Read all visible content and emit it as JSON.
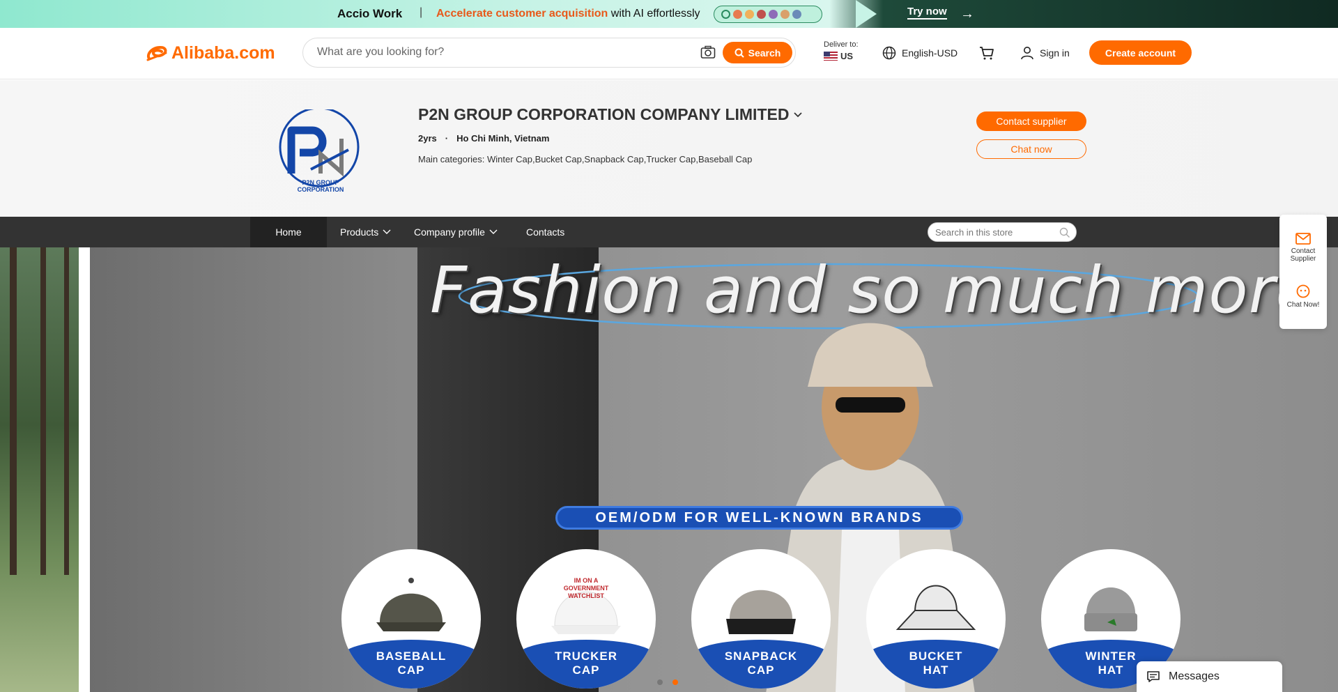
{
  "promo": {
    "brand": "Accio Work",
    "separator": "|",
    "highlight": "Accelerate customer acquisition",
    "rest": " with AI effortlessly",
    "cta": "Try now",
    "cta_arrow": "→"
  },
  "header": {
    "logo_text": "Alibaba.com",
    "search_placeholder": "What are you looking for?",
    "search_button": "Search",
    "deliver_label": "Deliver to:",
    "deliver_country": "US",
    "language": "English-USD",
    "sign_in": "Sign in",
    "create_account": "Create account"
  },
  "supplier": {
    "logo_caption": "P2N GROUP CORPORATION",
    "name": "P2N GROUP CORPORATION COMPANY LIMITED",
    "years": "2yrs",
    "dot": "·",
    "location": "Ho Chi Minh, Vietnam",
    "categories": "Main categories: Winter Cap,Bucket Cap,Snapback Cap,Trucker Cap,Baseball Cap",
    "contact_button": "Contact supplier",
    "chat_button": "Chat now"
  },
  "store_nav": {
    "items": [
      "Home",
      "Products",
      "Company profile",
      "Contacts"
    ],
    "search_placeholder": "Search in this store"
  },
  "hero": {
    "slogan": "Fashion and so much more",
    "badge": "OEM/ODM FOR WELL-KNOWN BRANDS",
    "caps": [
      {
        "label": "BASEBALL\nCAP"
      },
      {
        "label": "TRUCKER\nCAP",
        "print": "IM ON A GOVERNMENT WATCHLIST"
      },
      {
        "label": "SNAPBACK\nCAP"
      },
      {
        "label": "BUCKET\nHAT"
      },
      {
        "label": "WINTER\nHAT"
      }
    ]
  },
  "side_widget": {
    "contact": "Contact Supplier",
    "chat": "Chat Now!"
  },
  "messages": {
    "label": "Messages"
  },
  "colors": {
    "accent": "#ff6a00",
    "nav_bg": "#333333",
    "badge_blue": "#1a4fb4"
  },
  "icons": [
    "camera-icon",
    "search-icon",
    "globe-icon",
    "cart-icon",
    "user-icon",
    "chevron-down-icon",
    "envelope-icon",
    "chat-bubble-icon",
    "message-icon"
  ]
}
